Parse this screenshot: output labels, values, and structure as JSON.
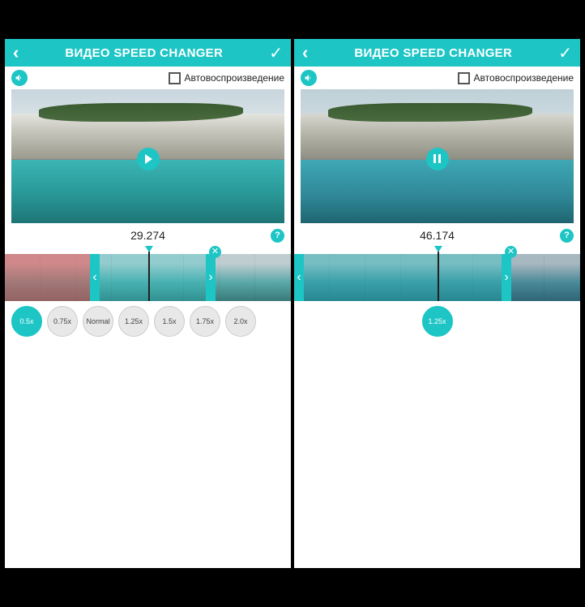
{
  "left": {
    "header": {
      "title": "ВИДЕО SPEED CHANGER"
    },
    "autoplay_label": "Автовоспроизведение",
    "timecode": "29.274",
    "help": "?",
    "speeds": [
      "0.5x",
      "0.75x",
      "Normal",
      "1.25x",
      "1.5x",
      "1.75x",
      "2.0x"
    ],
    "active_speed": "0.5x",
    "close_x": "✕"
  },
  "right": {
    "header": {
      "title": "ВИДЕО SPEED CHANGER"
    },
    "autoplay_label": "Автовоспроизведение",
    "timecode": "46.174",
    "help": "?",
    "speeds": [
      "1.25x"
    ],
    "active_speed": "1.25x",
    "close_x": "✕"
  }
}
